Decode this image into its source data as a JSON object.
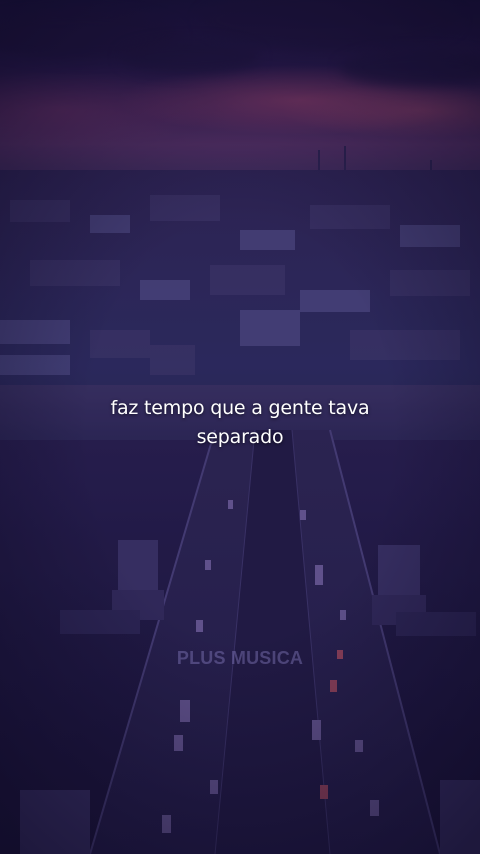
{
  "caption": {
    "line1": "faz tempo que a gente tava",
    "line2": "separado"
  },
  "watermark": "PLUS MUSICA",
  "colors": {
    "overlay_tint": "#2a1f5c",
    "sky_glow": "#a0466e",
    "caption_text": "#ffffff",
    "watermark_text": "#968cd2"
  }
}
